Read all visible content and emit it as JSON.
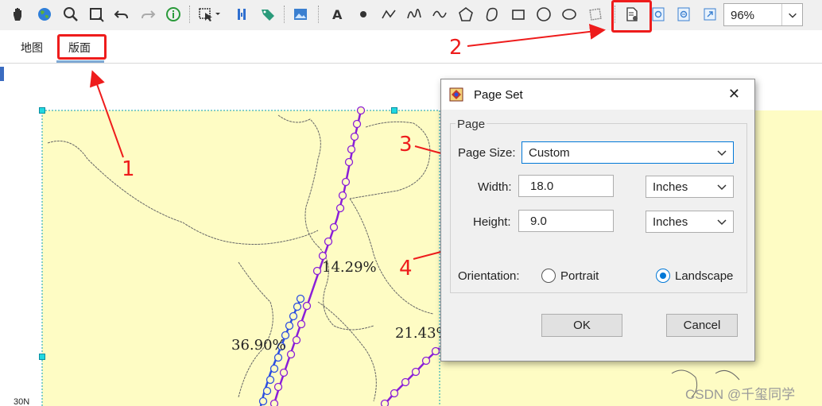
{
  "toolbar": {
    "zoom_value": "96%",
    "tools": [
      "pan-icon",
      "globe-icon",
      "zoom-icon",
      "zoom-extent-icon",
      "undo-icon",
      "redo-icon",
      "info-icon",
      "select-icon",
      "column-icon",
      "tag-icon",
      "image-icon",
      "text-icon",
      "point-icon",
      "polyline-icon",
      "curve-icon",
      "freehand-icon",
      "polygon-icon",
      "blob-icon",
      "rectangle-icon",
      "circle-icon",
      "ellipse-icon",
      "shape-icon",
      "page-setup-icon",
      "zoom-in-page-icon",
      "zoom-out-page-icon",
      "fit-page-icon"
    ]
  },
  "tabs": [
    {
      "label": "地图",
      "active": false
    },
    {
      "label": "版面",
      "active": true
    }
  ],
  "map": {
    "labels": [
      "14.29%",
      "36.90%",
      "21.43%"
    ],
    "lat_label": "30N"
  },
  "annotations": [
    "1",
    "2",
    "3",
    "4"
  ],
  "watermark": "CSDN @千玺同学",
  "dialog": {
    "title": "Page Set",
    "group_label": "Page",
    "page_size_label": "Page Size:",
    "page_size_value": "Custom",
    "width_label": "Width:",
    "width_value": "18.0",
    "width_unit": "Inches",
    "height_label": "Height:",
    "height_value": "9.0",
    "height_unit": "Inches",
    "orientation_label": "Orientation:",
    "portrait_label": "Portrait",
    "landscape_label": "Landscape",
    "orientation_selected": "Landscape",
    "ok_label": "OK",
    "cancel_label": "Cancel"
  },
  "colors": {
    "annotation_red": "#ee1c1c",
    "map_fill": "#fefcc4",
    "track_purple": "#8a1ed8",
    "track_blue": "#2c4ee0",
    "accent_blue": "#0078d7"
  }
}
